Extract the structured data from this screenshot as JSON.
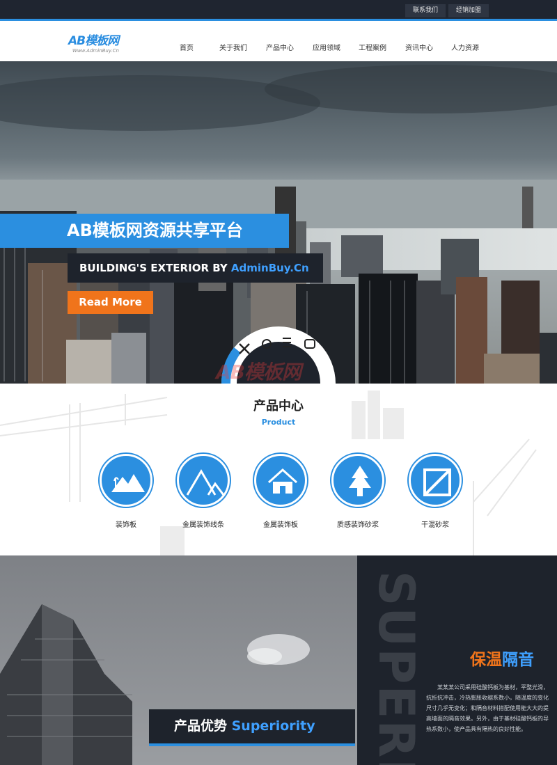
{
  "topbar": {
    "contact": "联系我们",
    "dealer": "经销加盟"
  },
  "logo": {
    "main": "AB模板网",
    "sub": "Www.AdminBuy.Cn"
  },
  "nav": [
    "首页",
    "关于我们",
    "产品中心",
    "应用领域",
    "工程案例",
    "资讯中心",
    "人力资源"
  ],
  "banner": {
    "headline": "AB模板网资源共享平台",
    "subline_prefix": "BUILDING'S EXTERIOR BY ",
    "subline_highlight": "AdminBuy.Cn",
    "button": "Read More",
    "watermark": "AB模板网"
  },
  "products": {
    "title": "产品中心",
    "subtitle": "Product",
    "items": [
      {
        "label": "装饰板",
        "icon": "mountain-icon"
      },
      {
        "label": "金属装饰线条",
        "icon": "peaks-icon"
      },
      {
        "label": "金属装饰板",
        "icon": "house-icon"
      },
      {
        "label": "质感装饰砂浆",
        "icon": "tree-icon"
      },
      {
        "label": "干混砂浆",
        "icon": "crate-icon"
      }
    ]
  },
  "advantage": {
    "tag_prefix": "产品优势 ",
    "tag_highlight": "Superiority",
    "vertical_text": "SUPERIORITY",
    "title_part1": "保温",
    "title_part2": "隔音",
    "body": "某某某公司采用硅酸钙板为基材，平整光滑，抗折抗冲击，冷热膨胀收缩系数小，随温度的变化尺寸几乎无变化；和隔音材料搭配使用能大大的提高墙面的隔音效果。另外，由于基材硅酸钙板的导热系数小，使产品具有隔热的良好性能。"
  },
  "colors": {
    "accent": "#2b8fe0",
    "orange": "#f0741b",
    "dark": "#1e232c"
  }
}
